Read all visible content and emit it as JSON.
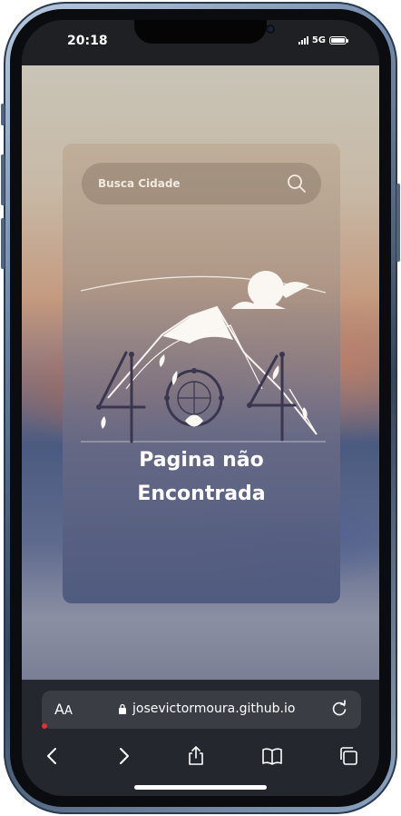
{
  "status_bar": {
    "time": "20:18",
    "network": "5G",
    "icons": [
      "signal-bars-icon",
      "battery-icon"
    ]
  },
  "page": {
    "search": {
      "placeholder": "Busca Cidade",
      "value": "",
      "icon": "search-icon"
    },
    "illustration": {
      "text": "404",
      "icon": "mountain-404-illustration"
    },
    "message": {
      "line1": "Pagina não",
      "line2": "Encontrada"
    }
  },
  "browser": {
    "text_size_label": "AA",
    "url": "josevictormoura.github.io",
    "toolbar": {
      "buttons": [
        "back-icon",
        "forward-icon",
        "share-icon",
        "bookmarks-icon",
        "tabs-icon"
      ]
    }
  },
  "colors": {
    "text_on_card": "#ffffff",
    "browser_chrome": "#24272e",
    "url_field": "#3a3d44"
  }
}
